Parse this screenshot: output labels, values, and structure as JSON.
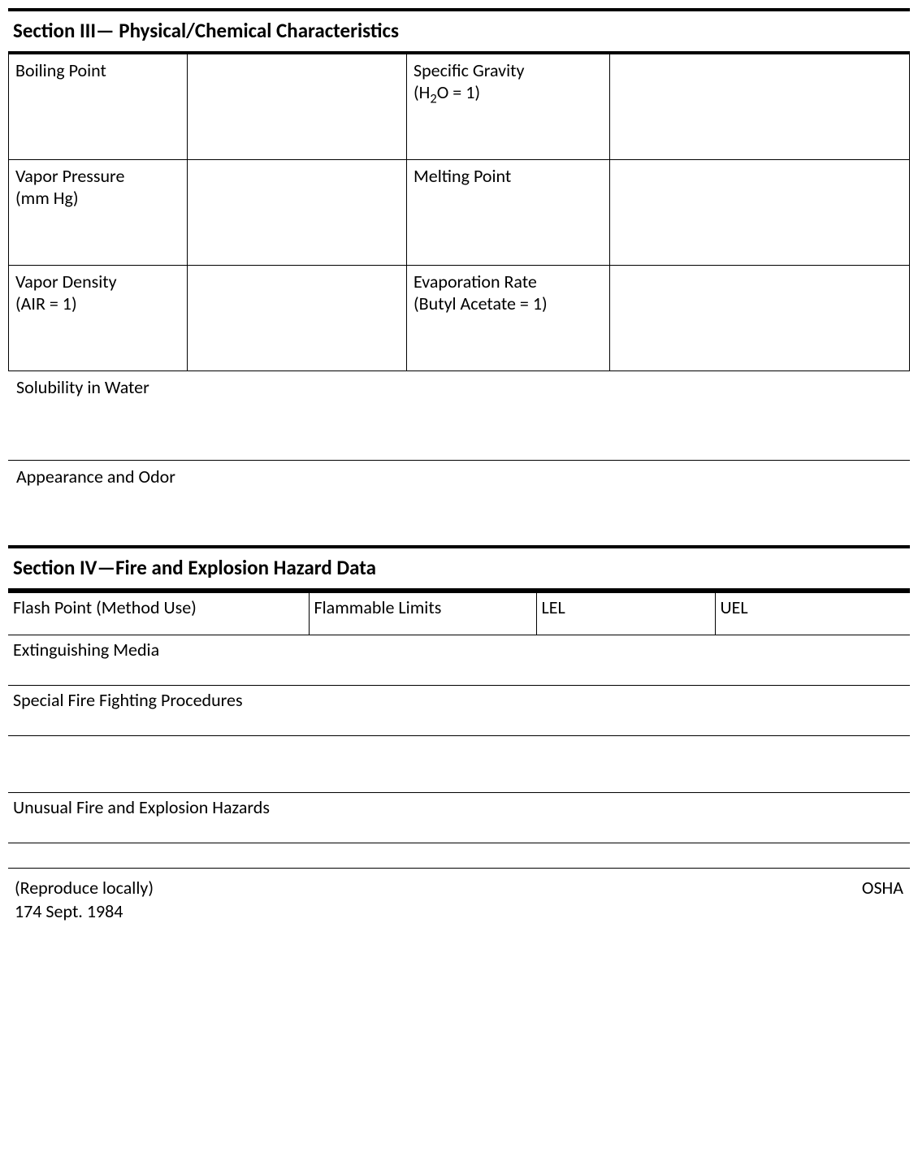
{
  "section3": {
    "title": "Section III— Physical/Chemical Characteristics",
    "rows": [
      {
        "label1": "Boiling Point",
        "value1": "",
        "label2_html": "Specific Gravity\n(H₂O = 1)",
        "value2": ""
      },
      {
        "label1": "Vapor Pressure\n(mm Hg)",
        "value1": "",
        "label2_html": "Melting Point",
        "value2": ""
      },
      {
        "label1": "Vapor Density\n(AIR = 1)",
        "value1": "",
        "label2_html": "Evaporation Rate\n(Butyl Acetate = 1)",
        "value2": ""
      }
    ],
    "solubility_label": "Solubility in Water",
    "appearance_label": "Appearance and Odor"
  },
  "section4": {
    "title": "Section IV—Fire and Explosion Hazard Data",
    "row1": {
      "flash_point": "Flash Point (Method Use)",
      "flammable_limits": "Flammable Limits",
      "lel": "LEL",
      "uel": "UEL"
    },
    "extinguishing": "Extinguishing Media",
    "special_fire": "Special Fire Fighting Procedures",
    "unusual": "Unusual Fire and Explosion Hazards"
  },
  "footer": {
    "left": "(Reproduce locally)\n174 Sept. 1984",
    "right": "OSHA"
  }
}
